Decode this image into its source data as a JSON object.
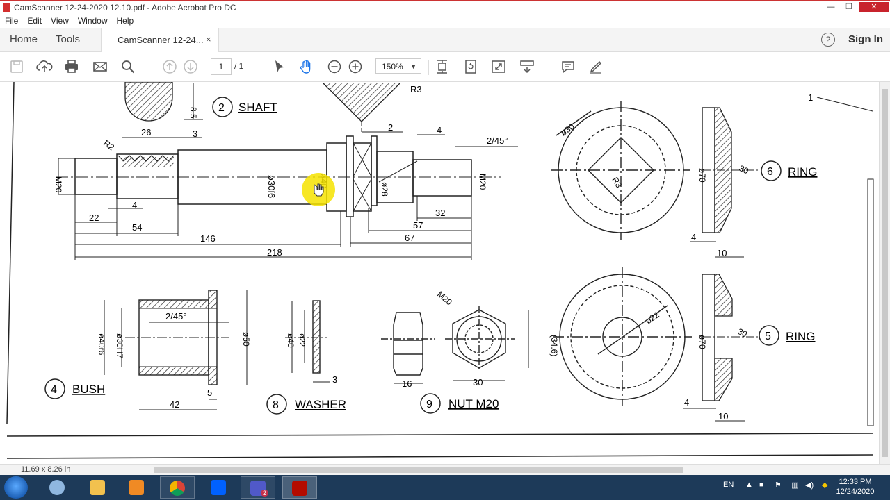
{
  "window": {
    "title": "CamScanner 12-24-2020 12.10.pdf - Adobe Acrobat Pro DC"
  },
  "menu": [
    "File",
    "Edit",
    "View",
    "Window",
    "Help"
  ],
  "nav": {
    "home": "Home",
    "tools": "Tools"
  },
  "tab": {
    "label": "CamScanner 12-24...",
    "close": "×"
  },
  "help": "?",
  "sign_in": "Sign In",
  "toolbar": {
    "page_current": "1",
    "page_total": "/ 1",
    "zoom": "150%"
  },
  "drawing": {
    "shaft": {
      "number": "2",
      "name": "SHAFT",
      "dims": [
        "8.5",
        "R3",
        "R2",
        "26",
        "3",
        "2",
        "4",
        "2/45°",
        "M20",
        "ø30f6",
        "ø40",
        "ø28",
        "M20",
        "4",
        "22",
        "54",
        "146",
        "218",
        "32",
        "57",
        "67"
      ]
    },
    "ring6": {
      "number": "6",
      "name": "RING",
      "dims": [
        "ø30",
        "R3",
        "ø70",
        "30",
        "4",
        "10",
        "1"
      ]
    },
    "bush": {
      "number": "4",
      "name": "BUSH",
      "dims": [
        "2/45°",
        "ø40r6",
        "ø30H7",
        "ø50",
        "5",
        "42"
      ]
    },
    "washer": {
      "number": "8",
      "name": "WASHER",
      "dims": [
        "ø40",
        "ø22",
        "3"
      ]
    },
    "nut": {
      "number": "9",
      "name": "NUT M20",
      "dims": [
        "M20",
        "(34.6)",
        "16",
        "30"
      ]
    },
    "ring5": {
      "number": "5",
      "name": "RING",
      "dims": [
        "ø22",
        "ø70",
        "30",
        "4",
        "10"
      ]
    }
  },
  "status": {
    "page_size": "11.69 x 8.26 in"
  },
  "taskbar": {
    "lang": "EN",
    "time": "12:33 PM",
    "date": "12/24/2020",
    "teams_badge": "2"
  }
}
